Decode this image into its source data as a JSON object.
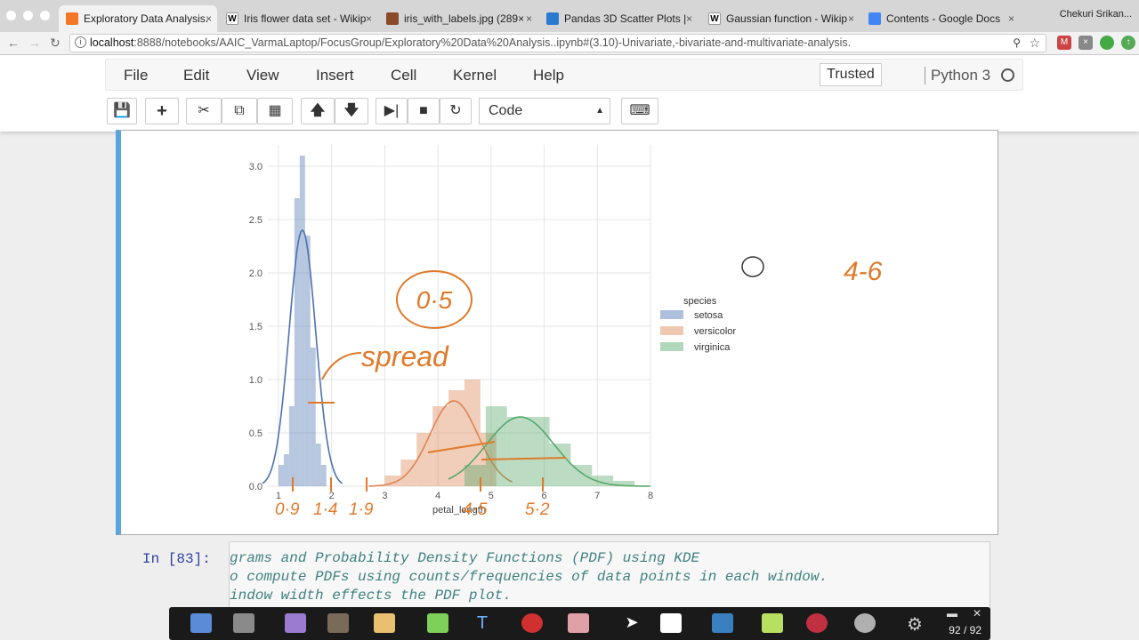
{
  "browser": {
    "tabs": [
      {
        "title": "Exploratory Data Analysis.",
        "favicon": "jupyter-icon",
        "color": "#f37726"
      },
      {
        "title": "Iris flower data set - Wikip",
        "favicon": "wikipedia-icon",
        "color": "#ffffff"
      },
      {
        "title": "iris_with_labels.jpg (289×",
        "favicon": "image-icon",
        "color": "#8a4a2a"
      },
      {
        "title": "Pandas 3D Scatter Plots |",
        "favicon": "chart-icon",
        "color": "#2a7ad0"
      },
      {
        "title": "Gaussian function - Wikip",
        "favicon": "wikipedia-icon",
        "color": "#ffffff"
      },
      {
        "title": "Contents - Google Docs",
        "favicon": "docs-icon",
        "color": "#4285f4"
      }
    ],
    "profile": "Chekuri Srikan...",
    "url_host": "localhost",
    "url_rest": ":8888/notebooks/AAIC_VarmaLaptop/FocusGroup/Exploratory%20Data%20Analysis..ipynb#(3.10)-Univariate,-bivariate-and-multivariate-analysis."
  },
  "menubar": {
    "items": [
      "File",
      "Edit",
      "View",
      "Insert",
      "Cell",
      "Kernel",
      "Help"
    ],
    "trusted": "Trusted",
    "kernel": "Python 3"
  },
  "toolbar": {
    "cell_type": "Code",
    "buttons": [
      "save-icon",
      "plus-icon",
      "cut-icon",
      "copy-icon",
      "paste-icon",
      "arrow-up-icon",
      "arrow-down-icon",
      "run-icon",
      "stop-icon",
      "restart-icon",
      "keyboard-icon"
    ]
  },
  "chart_data": {
    "type": "histogram",
    "xlabel": "petal_length",
    "xlim": [
      0.8,
      8
    ],
    "ylim": [
      0,
      3.2
    ],
    "x_ticks": [
      1,
      2,
      3,
      4,
      5,
      6,
      7,
      8
    ],
    "y_ticks": [
      0.0,
      0.5,
      1.0,
      1.5,
      2.0,
      2.5,
      3.0
    ],
    "legend_title": "species",
    "legend_position": "right",
    "series": [
      {
        "name": "setosa",
        "color": "#4c72b0",
        "bins": [
          [
            1.0,
            1.1,
            0.2
          ],
          [
            1.1,
            1.2,
            0.3
          ],
          [
            1.2,
            1.3,
            0.75
          ],
          [
            1.3,
            1.4,
            2.7
          ],
          [
            1.4,
            1.5,
            3.1
          ],
          [
            1.5,
            1.6,
            2.35
          ],
          [
            1.6,
            1.7,
            1.3
          ],
          [
            1.7,
            1.8,
            0.4
          ],
          [
            1.8,
            1.9,
            0.2
          ]
        ],
        "kde_peak": [
          1.45,
          2.4
        ]
      },
      {
        "name": "versicolor",
        "color": "#dd8452",
        "bins": [
          [
            3.0,
            3.3,
            0.1
          ],
          [
            3.3,
            3.6,
            0.25
          ],
          [
            3.6,
            3.9,
            0.5
          ],
          [
            3.9,
            4.2,
            0.75
          ],
          [
            4.2,
            4.5,
            0.9
          ],
          [
            4.5,
            4.8,
            1.0
          ],
          [
            4.8,
            5.1,
            0.5
          ]
        ],
        "kde_peak": [
          4.3,
          0.8
        ]
      },
      {
        "name": "virginica",
        "color": "#55a868",
        "bins": [
          [
            4.5,
            4.9,
            0.2
          ],
          [
            4.9,
            5.3,
            0.75
          ],
          [
            5.3,
            5.7,
            0.65
          ],
          [
            5.7,
            6.1,
            0.65
          ],
          [
            6.1,
            6.5,
            0.4
          ],
          [
            6.5,
            6.9,
            0.2
          ],
          [
            6.9,
            7.3,
            0.1
          ],
          [
            7.3,
            7.7,
            0.05
          ]
        ],
        "kde_peak": [
          5.55,
          0.65
        ]
      }
    ]
  },
  "legend": {
    "title": "species",
    "items": [
      "setosa",
      "versicolor",
      "virginica"
    ]
  },
  "annotations": {
    "circle_value": "0·5",
    "spread": "spread",
    "top_right": "4-6",
    "bottom_values": [
      "0·9",
      "1·4",
      "1·9",
      "4·5",
      "5·2"
    ]
  },
  "code_cell": {
    "prompt": "In [83]:",
    "lines": [
      "grams and Probability Density Functions (PDF) using KDE",
      "o compute PDFs using counts/frequencies of data points in each window.",
      "indow width effects the PDF plot."
    ]
  },
  "pen_toolbar": {
    "page": "92 / 92"
  }
}
